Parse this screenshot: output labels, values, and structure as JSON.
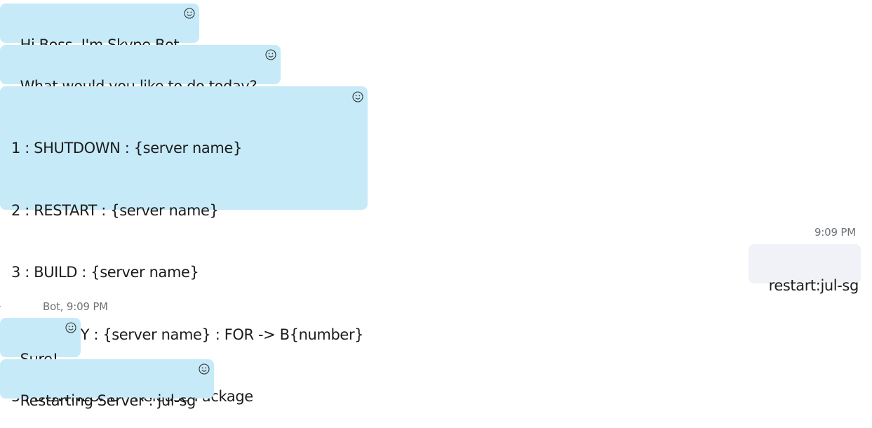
{
  "conversation": {
    "messages": [
      {
        "sender": "bot",
        "text": "Hi Boss. I'm Skype Bot"
      },
      {
        "sender": "bot",
        "text": "What would you like to do today?"
      },
      {
        "sender": "bot",
        "lines": [
          "1 : SHUTDOWN : {server name}",
          "2 : RESTART : {server name}",
          "3 : BUILD : {server name}",
          "4 : DEPLOY : {server name} : FOR -> B{number}",
          "5 : DOWNLOAD : Release Package"
        ]
      },
      {
        "sender": "self",
        "timestamp": "9:09 PM",
        "text": "restart:jul-sg"
      },
      {
        "sender": "bot",
        "header": "Bot, 9:09 PM",
        "text": "Sure!"
      },
      {
        "sender": "bot",
        "text": "Restarting Server : jul-sg"
      }
    ]
  },
  "colors": {
    "bot_bubble": "#c7eaf9",
    "self_bubble": "#f0f2f7",
    "meta_text": "#6d7278"
  },
  "icons": {
    "reaction": "smiley-face-icon"
  }
}
